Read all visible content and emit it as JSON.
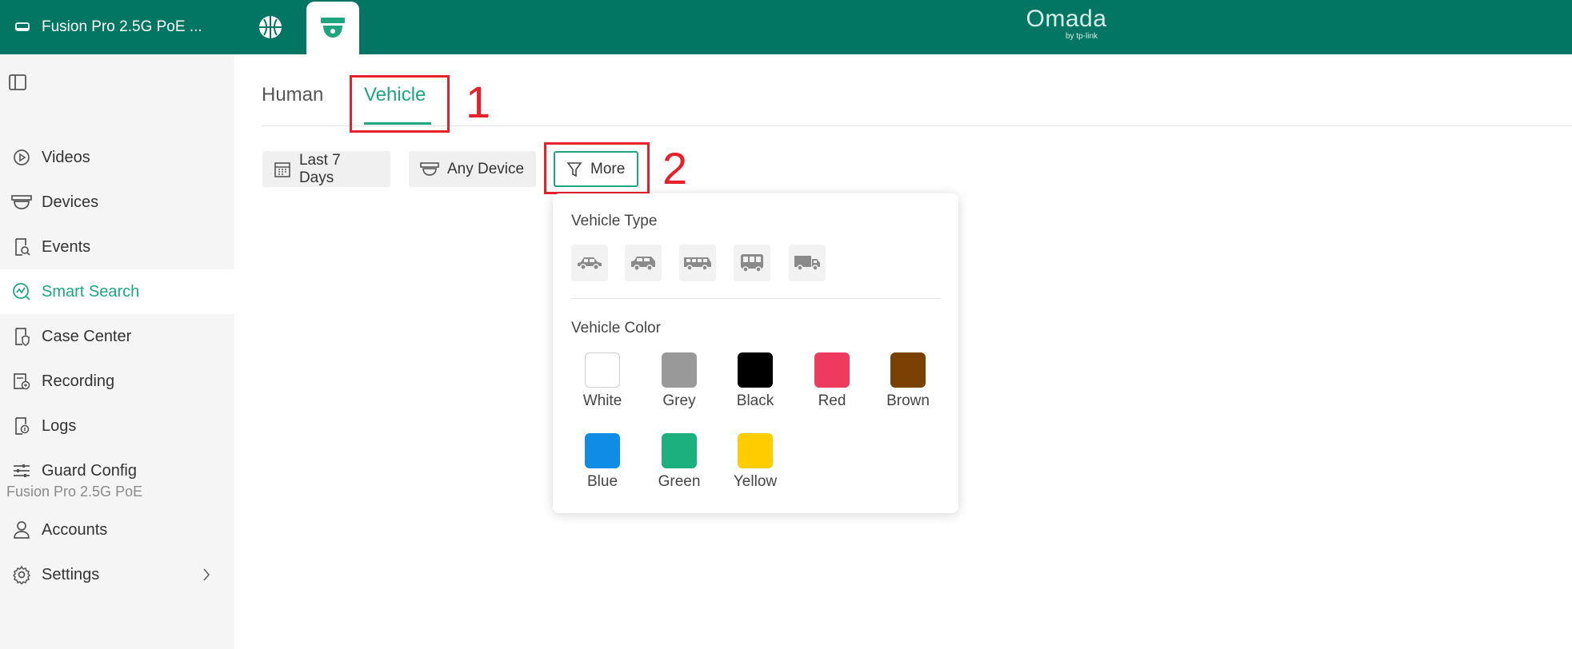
{
  "topbar": {
    "device_name": "Fusion Pro 2.5G PoE ...",
    "logo_brand": "Omada",
    "logo_sub": "by tp-link",
    "bg_color": "#027563"
  },
  "sidebar": {
    "items": [
      {
        "label": "Videos",
        "icon": "play-circle-icon"
      },
      {
        "label": "Devices",
        "icon": "camera-icon"
      },
      {
        "label": "Events",
        "icon": "event-search-icon"
      },
      {
        "label": "Smart Search",
        "icon": "smart-search-icon",
        "active": true
      },
      {
        "label": "Case Center",
        "icon": "case-icon"
      },
      {
        "label": "Recording",
        "icon": "recording-icon"
      },
      {
        "label": "Logs",
        "icon": "logs-icon"
      },
      {
        "label": "Guard Config",
        "icon": "sliders-icon"
      }
    ],
    "section_label": "Fusion Pro 2.5G PoE",
    "section_items": [
      {
        "label": "Accounts",
        "icon": "user-icon"
      },
      {
        "label": "Settings",
        "icon": "gear-icon"
      }
    ]
  },
  "tabs": [
    {
      "label": "Human",
      "active": false
    },
    {
      "label": "Vehicle",
      "active": true
    }
  ],
  "annotations": [
    "1",
    "2"
  ],
  "filters": {
    "date": "Last 7 Days",
    "device": "Any Device",
    "more": "More"
  },
  "panel": {
    "vehicle_type_title": "Vehicle Type",
    "vehicle_types": [
      "car-icon",
      "suv-icon",
      "minibus-icon",
      "bus-icon",
      "truck-icon"
    ],
    "vehicle_color_title": "Vehicle Color",
    "colors": [
      {
        "label": "White",
        "hex": "#ffffff"
      },
      {
        "label": "Grey",
        "hex": "#999999"
      },
      {
        "label": "Black",
        "hex": "#000000"
      },
      {
        "label": "Red",
        "hex": "#ee3a5f"
      },
      {
        "label": "Brown",
        "hex": "#7a4004"
      },
      {
        "label": "Blue",
        "hex": "#0f8de6"
      },
      {
        "label": "Green",
        "hex": "#1bb07e"
      },
      {
        "label": "Yellow",
        "hex": "#ffcc00"
      }
    ]
  },
  "accent_color": "#1fa67e",
  "highlight_color": "#e8202a"
}
